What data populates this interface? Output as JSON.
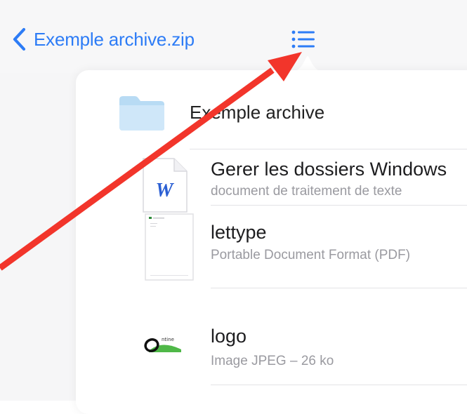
{
  "navbar": {
    "back_label": "Exemple archive.zip",
    "back_icon": "chevron-left-icon",
    "list_icon": "list-icon",
    "accent_color": "#2d7cf6"
  },
  "popover": {
    "folder": {
      "name": "Exemple archive",
      "icon": "folder-icon"
    },
    "files": [
      {
        "title": "Gerer les dossiers Windows",
        "subtitle": "document de traitement de texte",
        "icon": "word-document-icon",
        "thumb_letter": "W"
      },
      {
        "title": "lettype",
        "subtitle": "Portable Document Format (PDF)",
        "icon": "pdf-thumbnail-icon"
      },
      {
        "title": "logo",
        "subtitle": "Image JPEG – 26 ko",
        "icon": "jpeg-thumbnail-icon",
        "thumb_text": "ntine"
      }
    ]
  },
  "annotation": {
    "arrow_color": "#f2352b"
  }
}
